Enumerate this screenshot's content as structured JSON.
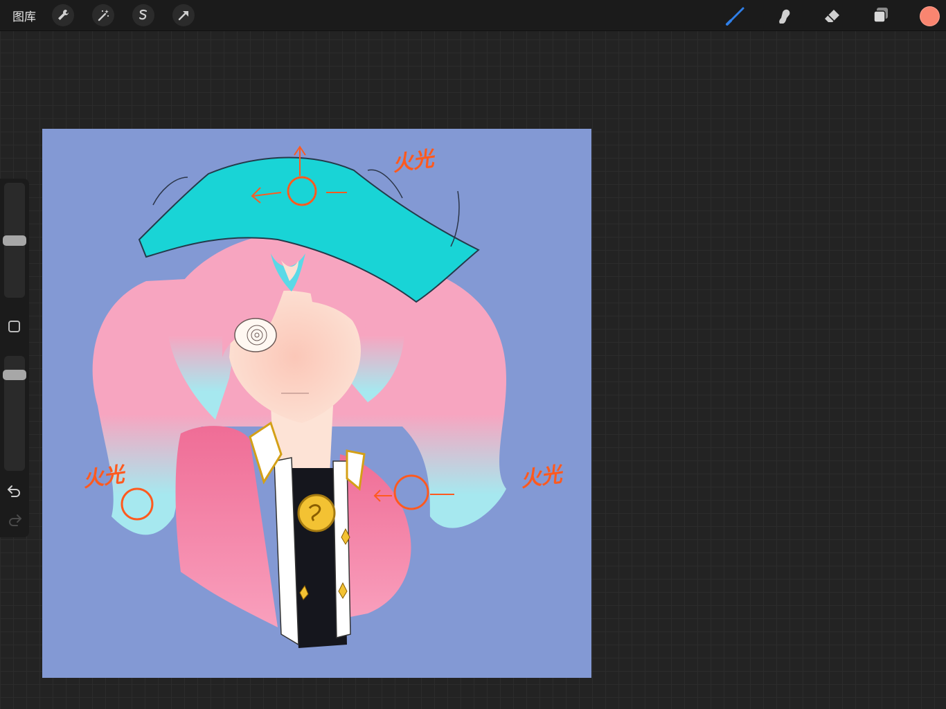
{
  "topbar": {
    "gallery_label": "图库",
    "left_tools": [
      "wrench-icon",
      "magic-wand-icon",
      "selection-icon",
      "transform-icon"
    ],
    "right_tools": [
      "brush-icon",
      "smudge-icon",
      "eraser-icon",
      "layers-icon"
    ],
    "active_tool": "brush",
    "current_color": "#f98570"
  },
  "sidebar": {
    "brush_size_level": 0.5,
    "opacity_level": 0.87,
    "buttons": [
      "modify-button",
      "undo-icon",
      "redo-icon"
    ]
  },
  "canvas": {
    "background_color": "#8399d4",
    "annotations": [
      "火光",
      "火光",
      "火光"
    ]
  },
  "colors": {
    "hat": "#19d4d6",
    "hair": "#f7a5c0",
    "hair_tips": "#a6e8ef",
    "cape": "#f0789f",
    "skin": "#fcd9cb",
    "annotation": "#ff5a1f",
    "active_tool": "#2f7fe7"
  }
}
